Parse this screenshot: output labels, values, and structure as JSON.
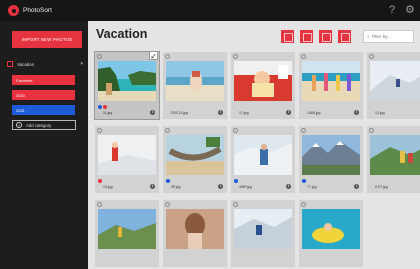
{
  "app": {
    "title": "PhotoSort",
    "help_icon": "help-icon",
    "settings_icon": "gear-icon"
  },
  "sidebar": {
    "import_label": "IMPORT NEW PHOTOS",
    "category_header": "Vacation",
    "items": [
      {
        "label": "Favorites",
        "color": "#e8323f"
      },
      {
        "label": "2020",
        "color": "#e8323f"
      },
      {
        "label": "2021",
        "color": "#1f5bd8"
      }
    ],
    "add_category_label": "Add category"
  },
  "main": {
    "title": "Vacation",
    "toolbar": [
      "delete-icon",
      "copy-icon",
      "move-icon",
      "tag-icon"
    ],
    "filter_placeholder": "Filter by..."
  },
  "photos": [
    {
      "file": "11.jpg",
      "selected": true,
      "tags": [
        "#1f5bd8",
        "#e8323f"
      ]
    },
    {
      "file": "DSC13.jpg",
      "selected": false,
      "tags": []
    },
    {
      "file": "17.jpg",
      "selected": false,
      "tags": []
    },
    {
      "file": "1488.jpg",
      "selected": false,
      "tags": []
    },
    {
      "file": "13.jpg",
      "selected": false,
      "tags": []
    },
    {
      "file": "13.jpg",
      "selected": false,
      "tags": [
        "#e8323f"
      ]
    },
    {
      "file": "4P.jpg",
      "selected": false,
      "tags": [
        "#1f5bd8"
      ]
    },
    {
      "file": "4WP.jpg",
      "selected": false,
      "tags": [
        "#1f5bd8"
      ]
    },
    {
      "file": "77.jpg",
      "selected": false,
      "tags": [
        "#1f5bd8"
      ]
    },
    {
      "file": "8.ST.jpg",
      "selected": false,
      "tags": []
    },
    {
      "file": "",
      "selected": false,
      "tags": []
    },
    {
      "file": "",
      "selected": false,
      "tags": []
    },
    {
      "file": "",
      "selected": false,
      "tags": []
    },
    {
      "file": "",
      "selected": false,
      "tags": []
    }
  ]
}
